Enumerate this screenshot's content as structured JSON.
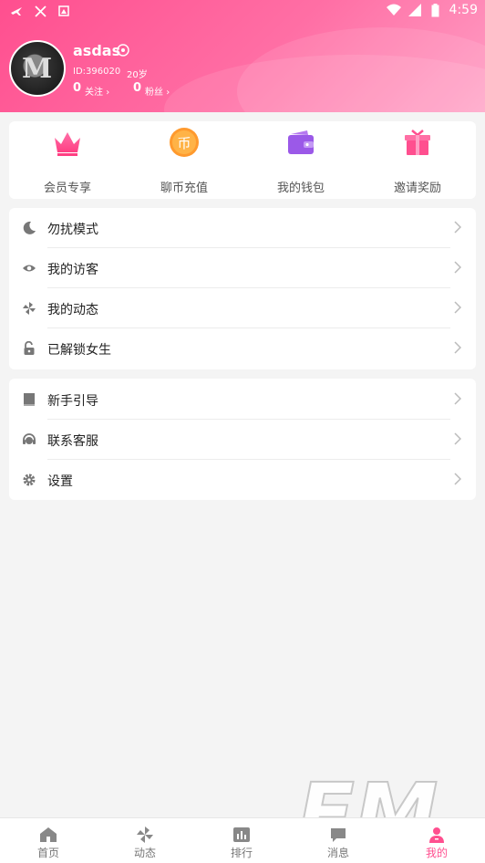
{
  "status_bar": {
    "time": "4:59"
  },
  "profile": {
    "username": "asdas",
    "user_id": "ID:396020",
    "age": "20岁",
    "follow_count": "0",
    "follow_label": "关注",
    "fans_count": "0",
    "fans_label": "粉丝"
  },
  "quick_actions": [
    {
      "label": "会员专享",
      "icon": "crown-icon"
    },
    {
      "label": "聊币充值",
      "icon": "coin-icon",
      "coin_char": "币"
    },
    {
      "label": "我的钱包",
      "icon": "wallet-icon"
    },
    {
      "label": "邀请奖励",
      "icon": "gift-icon"
    }
  ],
  "menu_group_1": [
    {
      "label": "勿扰模式",
      "icon": "moon-icon"
    },
    {
      "label": "我的访客",
      "icon": "eye-icon"
    },
    {
      "label": "我的动态",
      "icon": "pinwheel-icon"
    },
    {
      "label": "已解锁女生",
      "icon": "unlock-icon"
    }
  ],
  "menu_group_2": [
    {
      "label": "新手引导",
      "icon": "book-icon"
    },
    {
      "label": "联系客服",
      "icon": "headset-icon"
    },
    {
      "label": "设置",
      "icon": "gear-icon"
    }
  ],
  "tab_bar": [
    {
      "label": "首页",
      "icon": "home-icon"
    },
    {
      "label": "动态",
      "icon": "pinwheel-icon"
    },
    {
      "label": "排行",
      "icon": "ranking-icon"
    },
    {
      "label": "消息",
      "icon": "message-icon"
    },
    {
      "label": "我的",
      "icon": "profile-icon",
      "active": true
    }
  ],
  "colors": {
    "accent": "#ff4f8f",
    "header_start": "#ff4f8f",
    "header_end": "#ff9ec4"
  }
}
